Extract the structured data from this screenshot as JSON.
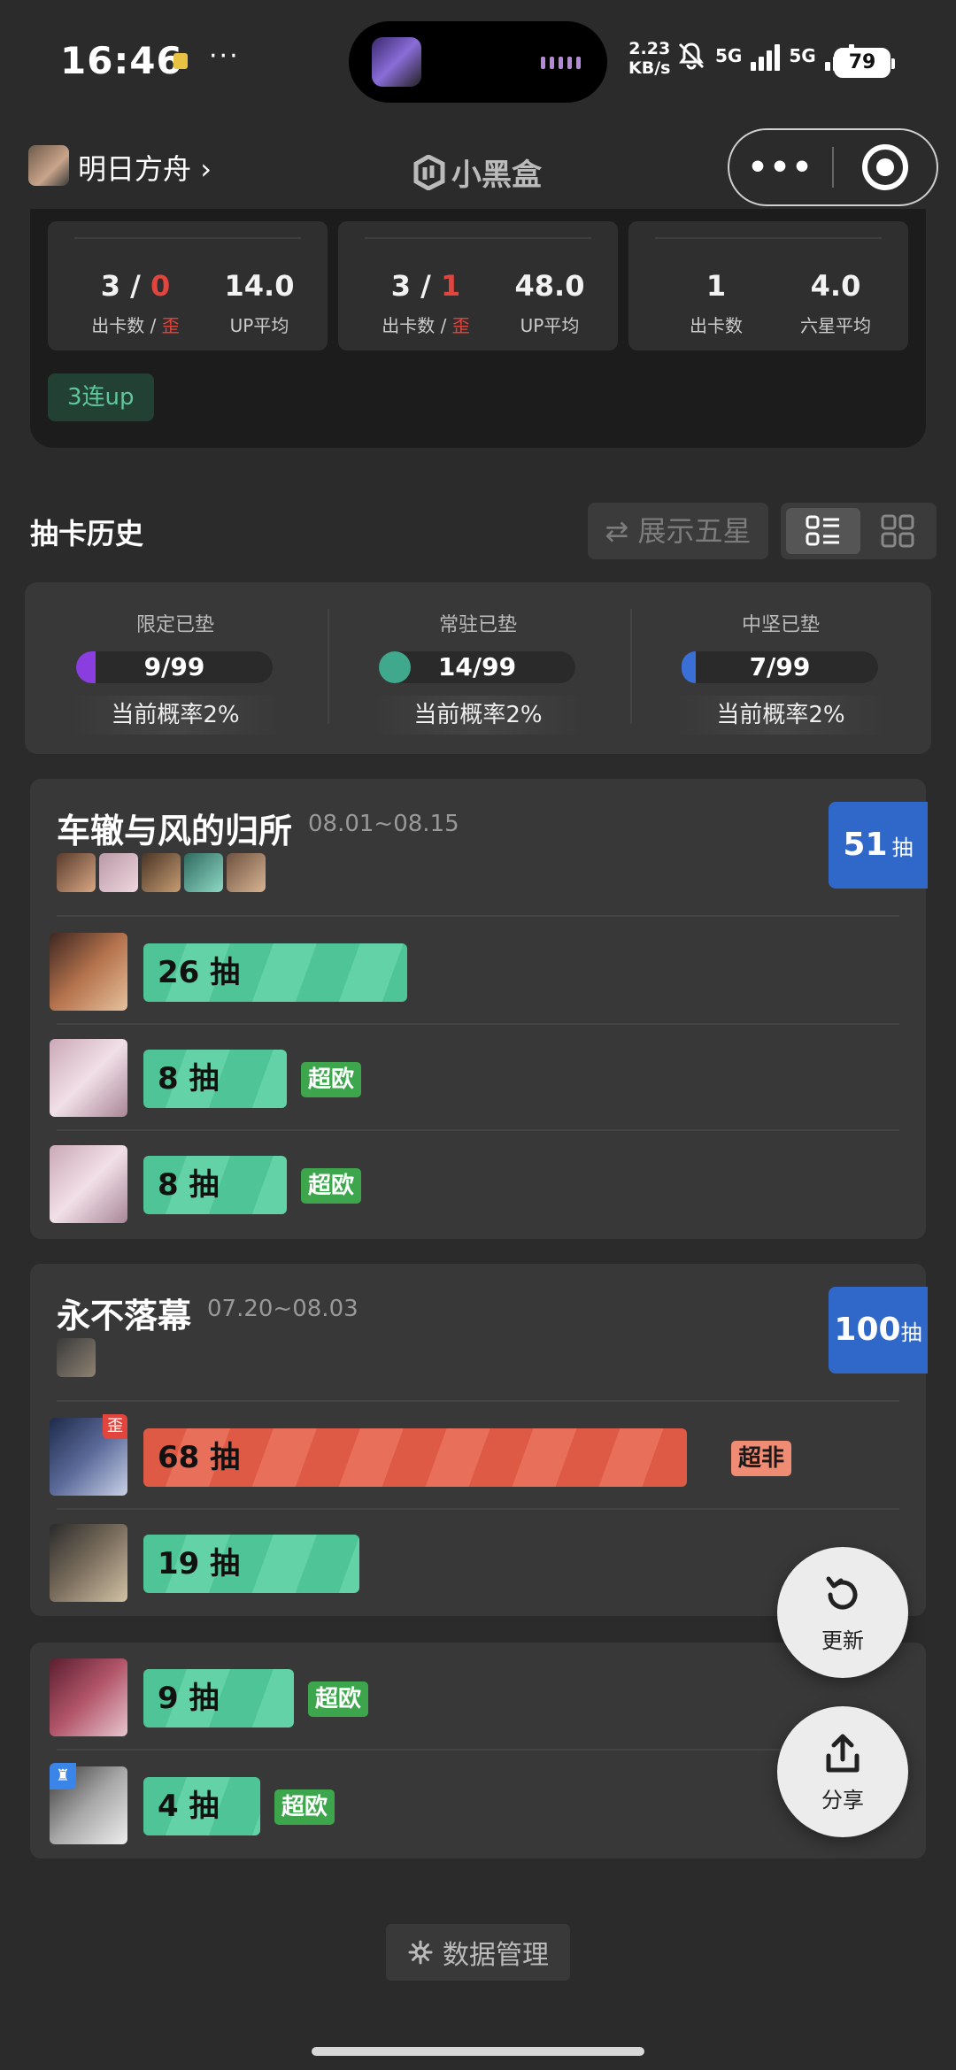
{
  "status_bar": {
    "time": "16:46",
    "net_speed_value": "2.23",
    "net_speed_unit": "KB/s",
    "net1": "5G",
    "net2": "5G",
    "battery": "79"
  },
  "nav": {
    "title": "明日方舟",
    "chevron": "›",
    "logo_text": "小黑盒",
    "more_label": "•••"
  },
  "summary": {
    "boxes": [
      {
        "pulls": "3",
        "off": "0",
        "pulls_label": "出卡数",
        "slash": " / ",
        "off_label": "歪",
        "avg": "14.0",
        "avg_label": "UP平均"
      },
      {
        "pulls": "3",
        "off": "1",
        "pulls_label": "出卡数",
        "slash": " / ",
        "off_label": "歪",
        "avg": "48.0",
        "avg_label": "UP平均"
      },
      {
        "pulls": "1",
        "pulls_label": "出卡数",
        "avg": "4.0",
        "avg_label": "六星平均"
      }
    ],
    "tag": "3连up"
  },
  "history": {
    "title": "抽卡历史",
    "show_five_label": "展示五星"
  },
  "pity": [
    {
      "label": "限定已垫",
      "value": "9/99",
      "current": 9,
      "max": 99,
      "rate": "当前概率2%",
      "color": "#8a3ee0"
    },
    {
      "label": "常驻已垫",
      "value": "14/99",
      "current": 14,
      "max": 99,
      "rate": "当前概率2%",
      "color": "#3fa88d"
    },
    {
      "label": "中坚已垫",
      "value": "7/99",
      "current": 7,
      "max": 99,
      "rate": "当前概率2%",
      "color": "#3a6fd6"
    }
  ],
  "banners": [
    {
      "title": "车辙与风的归所",
      "date": "08.01~08.15",
      "total": "51",
      "total_unit": "抽",
      "rows": [
        {
          "pulls": "26 抽",
          "tag": ""
        },
        {
          "pulls": "8 抽",
          "tag": "超欧"
        },
        {
          "pulls": "8 抽",
          "tag": "超欧"
        }
      ]
    },
    {
      "title": "永不落幕",
      "date": "07.20~08.03",
      "total": "100",
      "total_unit": "抽",
      "rows": [
        {
          "pulls": "68 抽",
          "tag": "超非",
          "badge": "歪"
        },
        {
          "pulls": "19 抽",
          "tag": ""
        }
      ]
    },
    {
      "rows": [
        {
          "pulls": "9 抽",
          "tag": "超欧"
        },
        {
          "pulls": "4 抽",
          "tag": "超欧",
          "badge": "♜"
        }
      ]
    }
  ],
  "fabs": {
    "refresh": "更新",
    "share": "分享"
  },
  "footer": {
    "data_mgmt": "数据管理"
  }
}
